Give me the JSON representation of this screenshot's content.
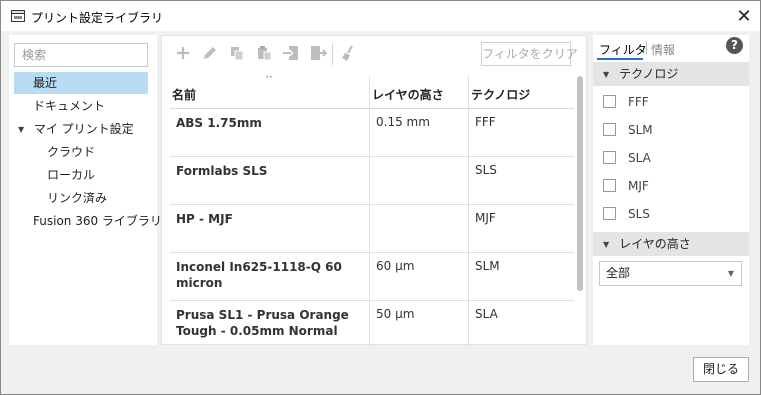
{
  "window": {
    "title": "プリント設定ライブラリ",
    "close_glyph": "✕"
  },
  "sidebar": {
    "search_placeholder": "検索",
    "items": [
      {
        "label": "最近",
        "selected": true
      },
      {
        "label": "ドキュメント"
      },
      {
        "label": "マイ プリント設定",
        "expanded": true
      },
      {
        "label": "クラウド"
      },
      {
        "label": "ローカル"
      },
      {
        "label": "リンク済み"
      },
      {
        "label": "Fusion 360 ライブラリ"
      }
    ],
    "expand_glyph": "▼"
  },
  "toolbar": {
    "icons": [
      "plus-icon",
      "pencil-icon",
      "copy-icon",
      "paste-icon",
      "import-icon",
      "export-icon",
      "broom-icon"
    ],
    "filter_clear_label": "フィルタをクリア"
  },
  "table": {
    "sort_glyph": "^",
    "columns": [
      "名前",
      "レイヤの高さ",
      "テクノロジ"
    ],
    "rows": [
      {
        "name": "ABS 1.75mm",
        "height": "0.15 mm",
        "tech": "FFF"
      },
      {
        "name": "Formlabs SLS",
        "height": "",
        "tech": "SLS"
      },
      {
        "name": "HP - MJF",
        "height": "",
        "tech": "MJF"
      },
      {
        "name": "Inconel In625-1118-Q 60 micron",
        "height": "60 µm",
        "tech": "SLM"
      },
      {
        "name": "Prusa SL1 - Prusa Orange Tough - 0.05mm Normal",
        "height": "50 µm",
        "tech": "SLA"
      }
    ]
  },
  "filter_panel": {
    "tabs": [
      "フィルタ",
      "情報"
    ],
    "help_glyph": "?",
    "technology_section": "テクノロジ",
    "technologies": [
      "FFF",
      "SLM",
      "SLA",
      "MJF",
      "SLS"
    ],
    "layer_height_section": "レイヤの高さ",
    "layer_height_value": "全部",
    "collapse_glyph": "▼",
    "dropdown_glyph": "▼"
  },
  "footer": {
    "close_label": "閉じる"
  }
}
